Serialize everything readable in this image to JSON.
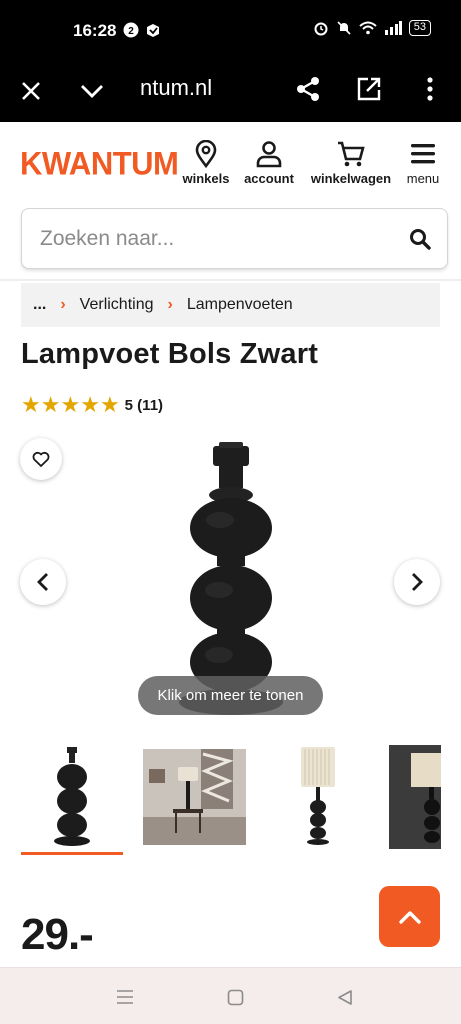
{
  "status": {
    "time": "16:28",
    "battery": "53"
  },
  "browser": {
    "url": "ntum.nl"
  },
  "header": {
    "logo": "KWANTUM",
    "nav": [
      {
        "label": "winkels",
        "icon": "location-pin-icon"
      },
      {
        "label": "account",
        "icon": "user-icon"
      },
      {
        "label": "winkelwagen",
        "icon": "cart-icon"
      },
      {
        "label": "menu",
        "icon": "hamburger-icon"
      }
    ]
  },
  "search": {
    "placeholder": "Zoeken naar...",
    "value": ""
  },
  "breadcrumb": {
    "ellipsis": "...",
    "items": [
      "Verlichting",
      "Lampenvoeten"
    ]
  },
  "product": {
    "title": "Lampvoet Bols Zwart",
    "rating": {
      "stars": 5,
      "label": "5 (11)"
    },
    "tooltip": "Klik om meer te tonen",
    "price": "29.-",
    "thumbnail_count_visible": 4,
    "active_thumbnail": 1
  },
  "colors": {
    "brand": "#f15a22",
    "star": "#e3a600"
  }
}
